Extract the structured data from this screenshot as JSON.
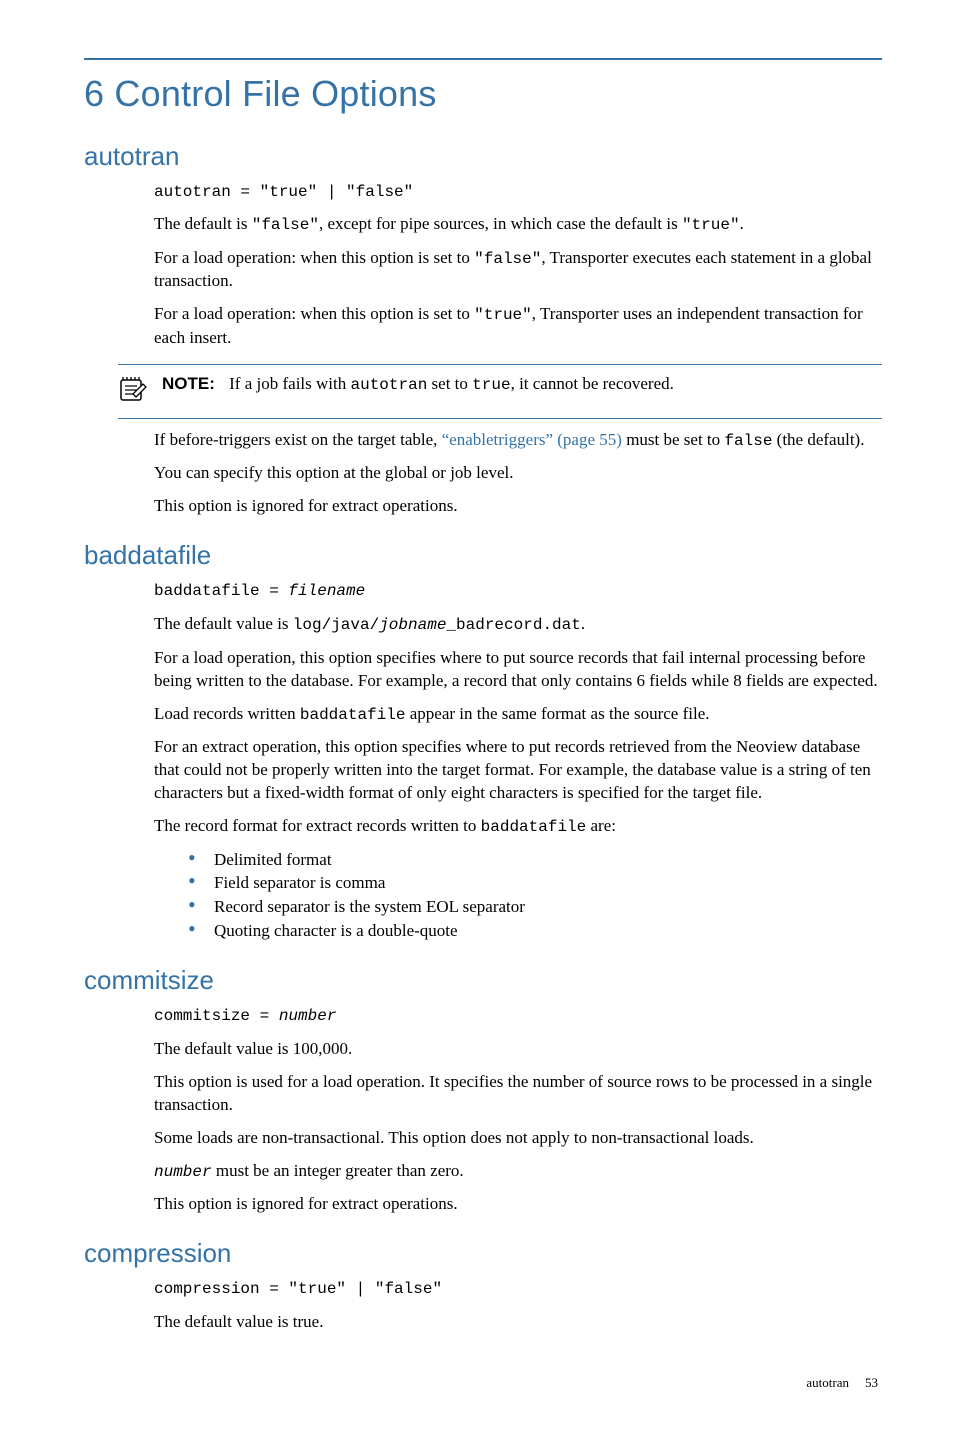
{
  "chapter_title": "6 Control File Options",
  "sections": {
    "autotran": {
      "heading": "autotran",
      "syntax_pre": "autotran = \"true\" | \"false\"",
      "p_default_a": "The default is ",
      "p_default_code1": "\"false\"",
      "p_default_b": ", except for pipe sources, in which case the default is ",
      "p_default_code2": "\"true\"",
      "p_default_c": ".",
      "p_false_a": "For a load operation: when this option is set to ",
      "p_false_code": "\"false\"",
      "p_false_b": ", Transporter executes each statement in a global transaction.",
      "p_true_a": "For a load operation: when this option is set to ",
      "p_true_code": "\"true\"",
      "p_true_b": ", Transporter uses an independent transaction for each insert.",
      "note_label": "NOTE:",
      "note_a": "If a job fails with ",
      "note_code1": "autotran",
      "note_b": " set to ",
      "note_code2": "true",
      "note_c": ", it cannot be recovered.",
      "p_trig_a": "If before-triggers exist on the target table, ",
      "p_trig_link": "“enabletriggers” (page 55)",
      "p_trig_b": " must be set to ",
      "p_trig_code": "false",
      "p_trig_c": " (the default).",
      "p_scope": "You can specify this option at the global or job level.",
      "p_ignored": "This option is ignored for extract operations."
    },
    "baddatafile": {
      "heading": "baddatafile",
      "syntax_a": "baddatafile = ",
      "syntax_ital": "filename",
      "p_def_a": "The default value is ",
      "p_def_code_a": "log/java/",
      "p_def_ital": "jobname",
      "p_def_code_b": "_badrecord.dat",
      "p_def_b": ".",
      "p_load": "For a load operation, this option specifies where to put source records that fail internal processing before being written to the database. For example, a record that only contains 6 fields while 8 fields are expected.",
      "p_same_a": "Load records written ",
      "p_same_code": "baddatafile",
      "p_same_b": " appear in the same format as the source file.",
      "p_extract": "For an extract operation, this option specifies where to put records retrieved from the Neoview database that could not be properly written into the target format. For example, the database value is a string of ten characters but a fixed-width format of only eight characters is specified for the target file.",
      "p_recfmt_a": "The record format for extract records written to ",
      "p_recfmt_code": "baddatafile",
      "p_recfmt_b": " are:",
      "bullets": [
        "Delimited format",
        "Field separator is comma",
        "Record separator is the system EOL separator",
        "Quoting character is a double-quote"
      ]
    },
    "commitsize": {
      "heading": "commitsize",
      "syntax_a": "commitsize = ",
      "syntax_ital": "number",
      "p_default": "The default value is 100,000.",
      "p_desc": "This option is used for a load operation. It specifies the number of source rows to be processed in a single transaction.",
      "p_nontx": "Some loads are non-transactional. This option does not apply to non-transactional loads.",
      "p_num_ital": "number",
      "p_num_b": " must be an integer greater than zero.",
      "p_ignored": "This option is ignored for extract operations."
    },
    "compression": {
      "heading": "compression",
      "syntax_pre": "compression = \"true\" | \"false\"",
      "p_default": "The default value is true."
    }
  },
  "footer": {
    "running": "autotran",
    "page": "53"
  }
}
